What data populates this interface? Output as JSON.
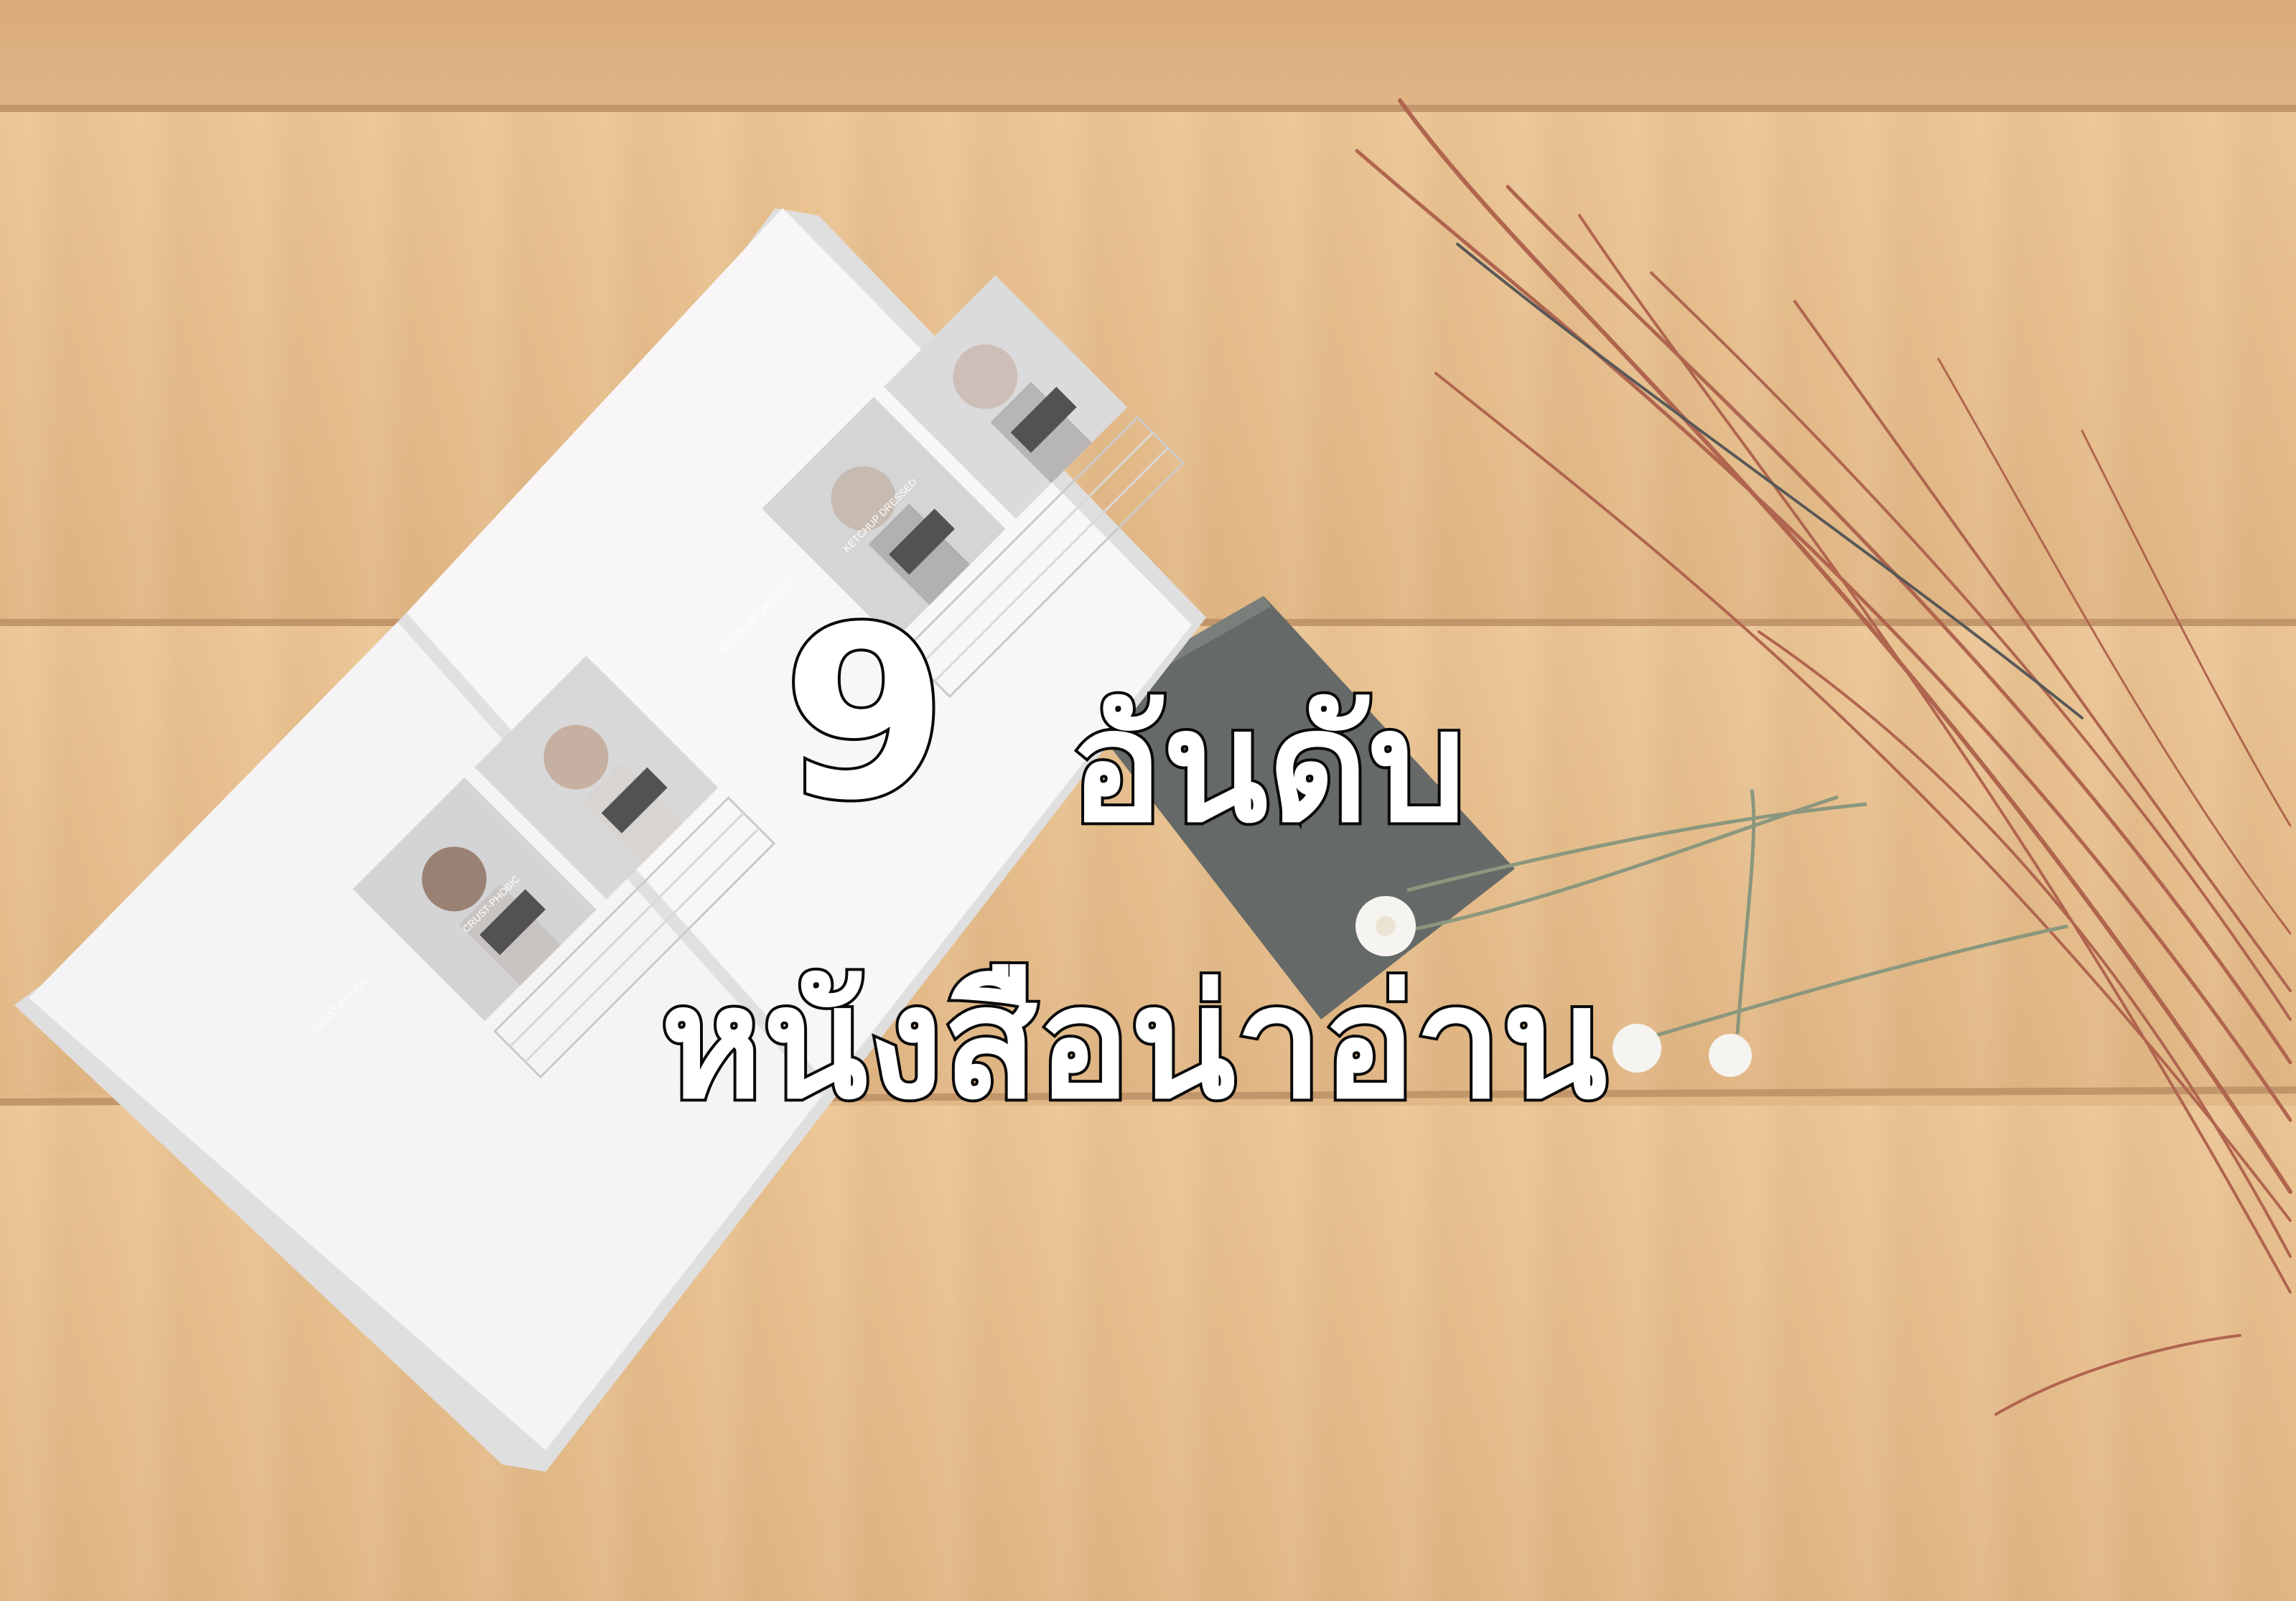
{
  "image": {
    "kind": "photo-with-overlay-text",
    "scene": "open photo book, dark notebook, dried reed twigs and small white flowers on a light wooden table",
    "colors": {
      "wood_light": "#e6b577",
      "wood_dark": "#c98e50",
      "plank_seam": "#a46a36",
      "page_white": "#f2f0f1",
      "notebook": "#3a3f3d",
      "twigs": "#9a3a1e",
      "text_fill": "#ffffff",
      "text_outline": "#0a0a0a"
    }
  },
  "overlay": {
    "number": "9",
    "word": "อันดับ",
    "subtitle": "หนังสือน่าอ่าน"
  },
  "book": {
    "left_page": {
      "tag_left": "CRUST-PHOBIC",
      "tag_right": "CRUST-PHOBIC"
    },
    "right_page": {
      "tag_left": "KETCHUP DRESSED",
      "tag_right": "KETCHUP DRESSED"
    }
  }
}
